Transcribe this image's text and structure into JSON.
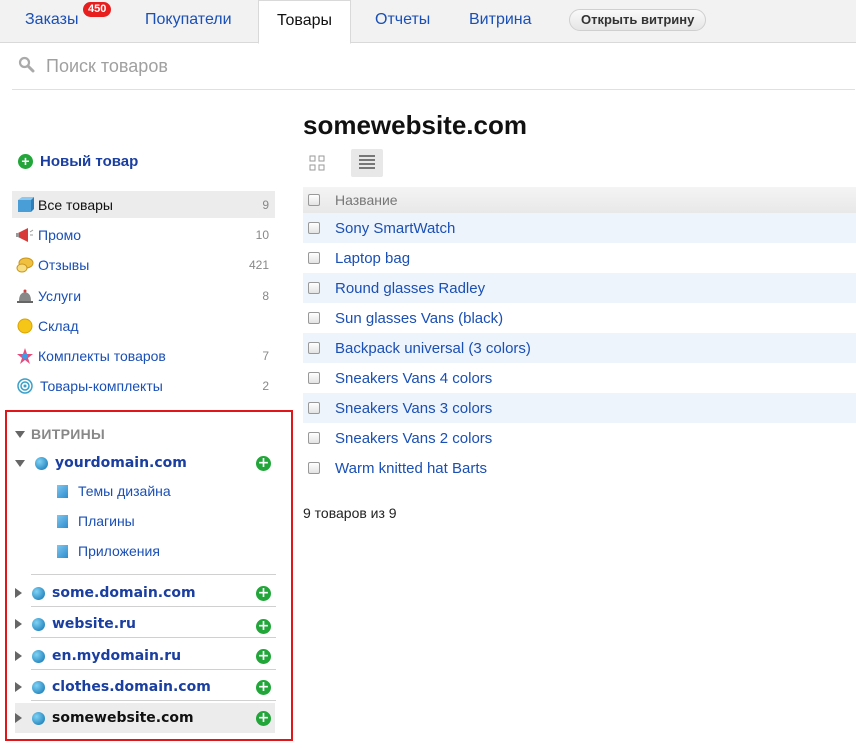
{
  "tabs": [
    {
      "label": "Заказы",
      "badge": "450"
    },
    {
      "label": "Покупатели"
    },
    {
      "label": "Товары"
    },
    {
      "label": "Отчеты"
    },
    {
      "label": "Витрина"
    }
  ],
  "open_storefront_label": "Открыть витрину",
  "search": {
    "placeholder": "Поиск товаров"
  },
  "sidebar": {
    "new_item_label": "Новый товар",
    "categories": [
      {
        "label": "Все товары",
        "count": "9",
        "icon": "box-icon"
      },
      {
        "label": "Промо",
        "count": "10",
        "icon": "megaphone-icon"
      },
      {
        "label": "Отзывы",
        "count": "421",
        "icon": "reviews-icon"
      },
      {
        "label": "Услуги",
        "count": "8",
        "icon": "bell-icon"
      },
      {
        "label": "Склад",
        "count": "",
        "icon": "warehouse-icon"
      },
      {
        "label": "Комплекты товаров",
        "count": "7",
        "icon": "star-icon"
      },
      {
        "label": "Товары-комплекты",
        "count": "2",
        "icon": "target-icon"
      }
    ],
    "storefronts_heading": "ВИТРИНЫ",
    "domains": [
      {
        "label": "yourdomain.com",
        "expanded": true,
        "children": [
          "Темы дизайна",
          "Плагины",
          "Приложения"
        ]
      },
      {
        "label": "some.domain.com"
      },
      {
        "label": "website.ru"
      },
      {
        "label": "en.mydomain.ru"
      },
      {
        "label": "clothes.domain.com"
      },
      {
        "label": "somewebsite.com",
        "active": true
      }
    ]
  },
  "main": {
    "title": "somewebsite.com",
    "column_name": "Название",
    "products": [
      "Sony SmartWatch",
      "Laptop bag",
      "Round glasses Radley",
      "Sun glasses Vans (black)",
      "Backpack universal (3 colors)",
      "Sneakers Vans 4 colors",
      "Sneakers Vans 3 colors",
      "Sneakers Vans 2 colors",
      "Warm knitted hat Barts"
    ],
    "count_text": "9 товаров из 9"
  },
  "colors": {
    "link": "#1a4fb5",
    "badge": "#e81d1d",
    "highlight_border": "#e0161a",
    "plus": "#22a63a"
  }
}
